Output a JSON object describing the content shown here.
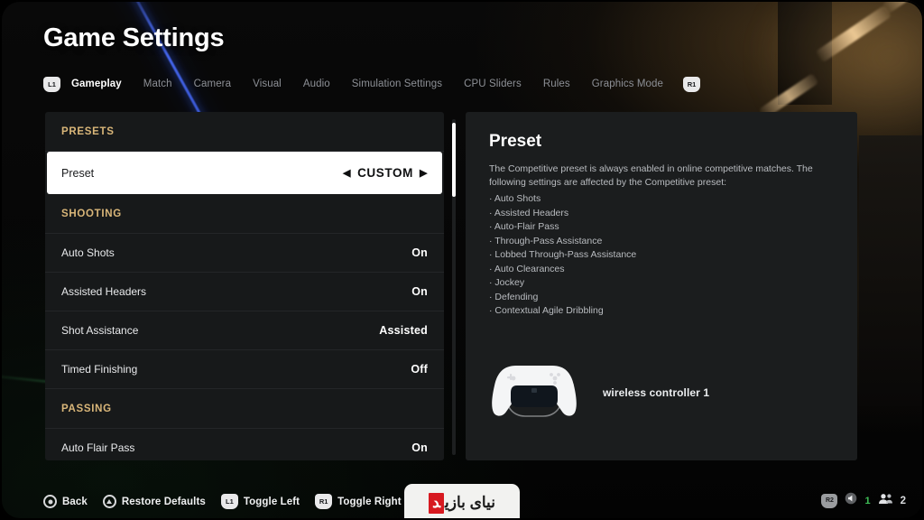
{
  "header": {
    "title": "Game Settings",
    "left_bumper": "L1",
    "right_bumper": "R1",
    "tabs": [
      {
        "label": "Gameplay",
        "active": true
      },
      {
        "label": "Match",
        "active": false
      },
      {
        "label": "Camera",
        "active": false
      },
      {
        "label": "Visual",
        "active": false
      },
      {
        "label": "Audio",
        "active": false
      },
      {
        "label": "Simulation Settings",
        "active": false
      },
      {
        "label": "CPU Sliders",
        "active": false
      },
      {
        "label": "Rules",
        "active": false
      },
      {
        "label": "Graphics Mode",
        "active": false
      }
    ]
  },
  "settings_list": {
    "items": [
      {
        "kind": "group",
        "label": "PRESETS"
      },
      {
        "kind": "selected",
        "label": "Preset",
        "value": "CUSTOM",
        "arrow_left": "◀",
        "arrow_right": "▶"
      },
      {
        "kind": "group",
        "label": "SHOOTING"
      },
      {
        "kind": "row",
        "label": "Auto Shots",
        "value": "On"
      },
      {
        "kind": "row",
        "label": "Assisted Headers",
        "value": "On"
      },
      {
        "kind": "row",
        "label": "Shot Assistance",
        "value": "Assisted"
      },
      {
        "kind": "row",
        "label": "Timed Finishing",
        "value": "Off"
      },
      {
        "kind": "group",
        "label": "PASSING"
      },
      {
        "kind": "row",
        "label": "Auto Flair Pass",
        "value": "On"
      }
    ]
  },
  "detail": {
    "title": "Preset",
    "body": "The Competitive preset is always enabled in online competitive matches. The following settings are affected by the Competitive preset:",
    "affected_settings": [
      "Auto Shots",
      "Assisted Headers",
      "Auto-Flair Pass",
      "Through-Pass Assistance",
      "Lobbed Through-Pass Assistance",
      "Auto Clearances",
      "Jockey",
      "Defending",
      "Contextual Agile Dribbling"
    ],
    "controller_label": "wireless controller 1"
  },
  "bottom_bar": {
    "hints": [
      {
        "icon": "circle-button-icon",
        "label": "Back"
      },
      {
        "icon": "triangle-button-icon",
        "label": "Restore Defaults"
      },
      {
        "icon": "l1-bumper-icon",
        "badge": "L1",
        "label": "Toggle Left"
      },
      {
        "icon": "r1-bumper-icon",
        "badge": "R1",
        "label": "Toggle Right"
      }
    ],
    "status_tray": {
      "bumper_badge": "R2",
      "volume_icon": "speaker-icon",
      "player_indicator": "1",
      "players_icon": "players-icon",
      "player_count": "2"
    }
  },
  "watermark": {
    "text_plain": "نیای بازی",
    "text_highlight": "د"
  },
  "colors": {
    "accent_group_header": "#d9b679",
    "selected_row_bg": "#ffffff",
    "panel_bg": "#17191a",
    "detail_panel_bg": "#1b1d1e",
    "player_indicator": "#3fbf57",
    "watermark_red": "#d71920",
    "streak_blue": "#4a6eff"
  }
}
